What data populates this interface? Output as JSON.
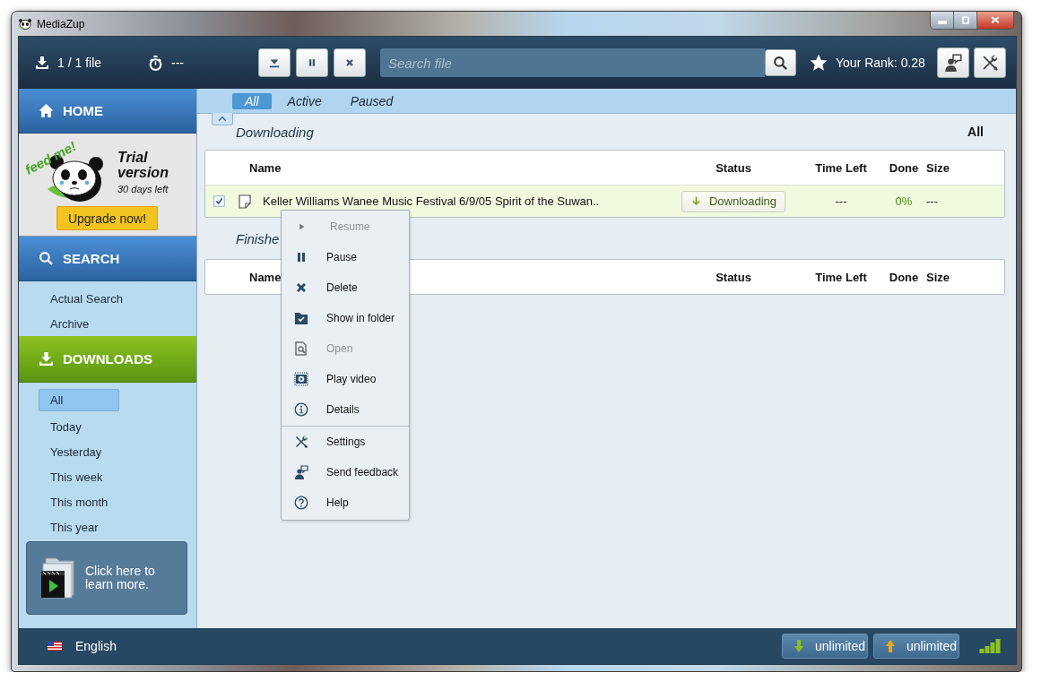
{
  "window": {
    "title": "MediaZup"
  },
  "toolbar": {
    "file_count": "1 / 1 file",
    "time_left": "---",
    "search": {
      "placeholder": "Search file"
    },
    "rank": "Your Rank: 0.28"
  },
  "sidebar": {
    "home": "HOME",
    "trial": {
      "badge": "feed me!",
      "title": "Trial version",
      "days_left": "30 days left",
      "upgrade": "Upgrade now!"
    },
    "search": {
      "title": "SEARCH",
      "items": [
        {
          "label": "Actual Search",
          "selected": false
        },
        {
          "label": "Archive",
          "selected": false
        }
      ]
    },
    "downloads": {
      "title": "DOWNLOADS",
      "items": [
        {
          "label": "All",
          "selected": true
        },
        {
          "label": "Today",
          "selected": false
        },
        {
          "label": "Yesterday",
          "selected": false
        },
        {
          "label": "This week",
          "selected": false
        },
        {
          "label": "This month",
          "selected": false
        },
        {
          "label": "This year",
          "selected": false
        }
      ]
    },
    "promo": "Click here to learn more."
  },
  "filter_tabs": [
    {
      "label": "All",
      "selected": true
    },
    {
      "label": "Active",
      "selected": false
    },
    {
      "label": "Paused",
      "selected": false
    }
  ],
  "downloading": {
    "title": "Downloading",
    "filter": "All",
    "columns": [
      "Name",
      "Status",
      "Time Left",
      "Done",
      "Size"
    ],
    "rows": [
      {
        "checked": true,
        "name": "Keller Williams Wanee Music Festival 6/9/05 Spirit of the Suwan..",
        "status": "Downloading",
        "time_left": "---",
        "done": "0%",
        "size": "---"
      }
    ]
  },
  "finished": {
    "title": "Finishe",
    "columns": [
      "Name",
      "Status",
      "Time Left",
      "Done",
      "Size"
    ]
  },
  "context_menu": [
    {
      "kind": "item",
      "label": "Resume",
      "disabled": true
    },
    {
      "kind": "item",
      "label": "Pause",
      "disabled": false
    },
    {
      "kind": "item",
      "label": "Delete",
      "disabled": false
    },
    {
      "kind": "item",
      "label": "Show in folder",
      "disabled": false
    },
    {
      "kind": "item",
      "label": "Open",
      "disabled": true
    },
    {
      "kind": "item",
      "label": "Play video",
      "disabled": false
    },
    {
      "kind": "item",
      "label": "Details",
      "disabled": false
    },
    {
      "kind": "separator"
    },
    {
      "kind": "item",
      "label": "Settings",
      "disabled": false
    },
    {
      "kind": "item",
      "label": "Send feedback",
      "disabled": false
    },
    {
      "kind": "item",
      "label": "Help",
      "disabled": false
    }
  ],
  "status_bar": {
    "language": "English",
    "download_limit": "unlimited",
    "upload_limit": "unlimited"
  }
}
